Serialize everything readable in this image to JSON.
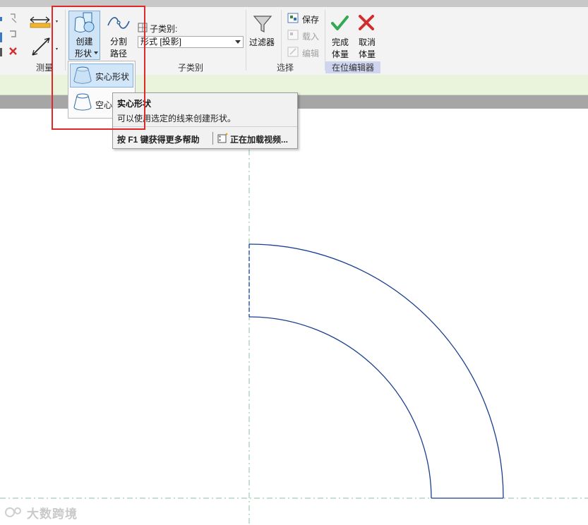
{
  "ribbon": {
    "measure_panel_label": "测量",
    "create_shape": {
      "line1": "创建",
      "line2": "形状"
    },
    "split_path": {
      "line1": "分割",
      "line2": "路径"
    },
    "subcategory": {
      "label": "子类别:",
      "value": "形式 [投影]",
      "panel_label": "子类别"
    },
    "select": {
      "filter_label": "过滤器",
      "panel_label": "选择"
    },
    "group": {
      "save": "保存",
      "load": "载入",
      "edit": "编辑"
    },
    "finish_mass": {
      "line1": "完成",
      "line2": "体量"
    },
    "cancel_mass": {
      "line1": "取消",
      "line2": "体量"
    },
    "in_place_editor_label": "在位编辑器"
  },
  "dropdown": {
    "solid_form": "实心形状",
    "void_form_partial": "空心"
  },
  "tooltip": {
    "title": "实心形状",
    "description": "可以使用选定的线来创建形状。",
    "help": "按 F1 键获得更多帮助",
    "video": "正在加载视频..."
  },
  "watermark": "大数跨境",
  "colors": {
    "highlight": "#e02828",
    "shape_line": "#1a3f8f",
    "ref_line": "#8fbf9f",
    "accent_green": "#34a853",
    "cancel_red": "#d42c2c"
  },
  "icons": [
    "measure-ruler-icon",
    "dimension-icon",
    "create-shape-icon",
    "split-path-icon",
    "filter-icon",
    "save-group-icon",
    "load-group-icon",
    "edit-group-icon",
    "checkmark-icon",
    "cancel-x-icon",
    "solid-form-icon",
    "void-form-icon",
    "video-icon"
  ]
}
